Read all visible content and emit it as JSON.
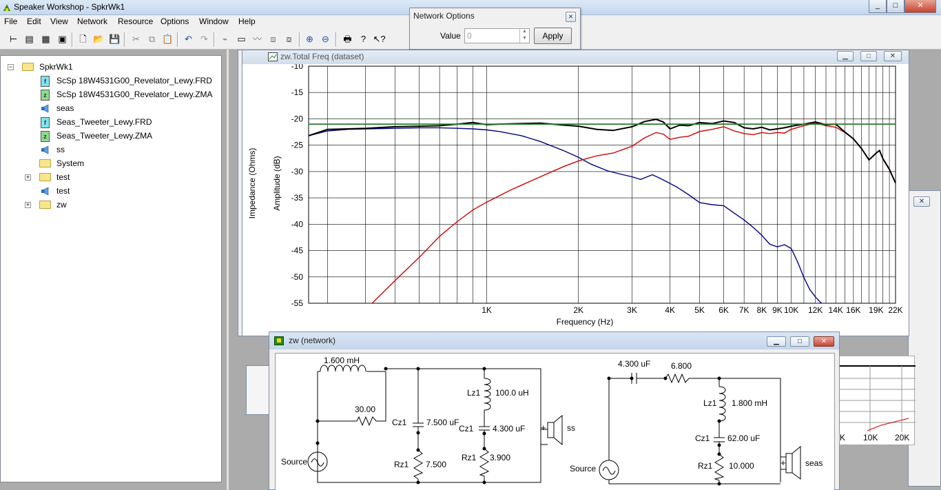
{
  "app": {
    "title": "Speaker Workshop - SpkrWk1",
    "caption_min": "_",
    "caption_max": "□",
    "caption_close": "✕"
  },
  "menu": [
    "File",
    "Edit",
    "View",
    "Network",
    "Resource",
    "Options",
    "Window",
    "Help"
  ],
  "toolbar": [
    "tree-view",
    "list-view",
    "details-view",
    "icons-view",
    "new",
    "open",
    "save",
    "cut",
    "copy",
    "paste",
    "undo",
    "redo",
    "measure",
    "chart",
    "impedance",
    "frequency",
    "transfer",
    "zoom-in",
    "zoom-out",
    "print",
    "help",
    "context-help"
  ],
  "network_options": {
    "title": "Network Options",
    "value_label": "Value",
    "value": "0",
    "apply_label": "Apply",
    "close": "✕"
  },
  "tree": {
    "items": [
      {
        "label": "SpkrWk1",
        "icon": "folder-icon",
        "expander": "−"
      },
      {
        "label": "ScSp 18W4531G00_Revelator_Lewy.FRD",
        "icon": "frequency-file-icon",
        "glyph": "f"
      },
      {
        "label": "ScSp 18W4531G00_Revelator_Lewy.ZMA",
        "icon": "impedance-file-icon",
        "glyph": "z"
      },
      {
        "label": "seas",
        "icon": "driver-icon"
      },
      {
        "label": "Seas_Tweeter_Lewy.FRD",
        "icon": "frequency-file-icon",
        "glyph": "f"
      },
      {
        "label": "Seas_Tweeter_Lewy.ZMA",
        "icon": "impedance-file-icon",
        "glyph": "z"
      },
      {
        "label": "ss",
        "icon": "driver-icon"
      },
      {
        "label": "System",
        "icon": "folder-icon"
      },
      {
        "label": "test",
        "icon": "folder-icon",
        "expander": "+"
      },
      {
        "label": "test",
        "icon": "driver-icon"
      },
      {
        "label": "zw",
        "icon": "folder-icon",
        "expander": "+"
      }
    ]
  },
  "freq_window": {
    "title": "zw.Total Freq (dataset)"
  },
  "network_window": {
    "title": "zw (network)"
  },
  "chart_data": {
    "type": "line",
    "x_scale": "log",
    "xlim": [
      260,
      22000
    ],
    "ylim": [
      -55,
      -10
    ],
    "xlabel": "Frequency (Hz)",
    "ylabel": "Amplitude (dB)",
    "y2label": "Impedance (Ohms)",
    "xticks": [
      {
        "v": 1000,
        "l": "1K"
      },
      {
        "v": 2000,
        "l": "2K"
      },
      {
        "v": 3000,
        "l": "3K"
      },
      {
        "v": 4000,
        "l": "4K"
      },
      {
        "v": 5000,
        "l": "5K"
      },
      {
        "v": 6000,
        "l": "6K"
      },
      {
        "v": 7000,
        "l": "7K"
      },
      {
        "v": 8000,
        "l": "8K"
      },
      {
        "v": 9000,
        "l": "9K"
      },
      {
        "v": 10000,
        "l": "10K"
      },
      {
        "v": 12000,
        "l": "12K"
      },
      {
        "v": 14000,
        "l": "14K"
      },
      {
        "v": 16000,
        "l": "16K"
      },
      {
        "v": 19000,
        "l": "19K"
      },
      {
        "v": 22000,
        "l": "22K"
      }
    ],
    "yticks": [
      -10,
      -15,
      -20,
      -25,
      -30,
      -35,
      -40,
      -45,
      -50,
      -55
    ],
    "grid": true,
    "series": [
      {
        "color": "#00007f",
        "width": 1.4,
        "x": [
          260,
          300,
          350,
          400,
          500,
          600,
          700,
          800,
          900,
          1000,
          1100,
          1300,
          1500,
          1800,
          2000,
          2200,
          2500,
          2800,
          3000,
          3200,
          3500,
          3800,
          4200,
          4600,
          5000,
          5500,
          6000,
          6500,
          7000,
          7500,
          8000,
          8500,
          9000,
          9500,
          10000,
          10500,
          11000,
          11500,
          12000,
          12500,
          13000
        ],
        "y": [
          -23.2,
          -22.3,
          -22.0,
          -21.9,
          -21.8,
          -21.7,
          -21.7,
          -21.8,
          -21.9,
          -22.1,
          -22.4,
          -23.2,
          -24.3,
          -26.1,
          -27.3,
          -28.6,
          -29.9,
          -30.6,
          -31.0,
          -31.5,
          -30.6,
          -31.6,
          -32.9,
          -34.4,
          -35.9,
          -36.3,
          -36.5,
          -37.9,
          -39.2,
          -40.6,
          -42.1,
          -43.8,
          -44.3,
          -43.9,
          -44.6,
          -47.2,
          -50.1,
          -52.4,
          -53.8,
          -54.9,
          -55.5
        ]
      },
      {
        "color": "#d00000",
        "width": 1.4,
        "x": [
          420,
          500,
          600,
          700,
          800,
          900,
          1000,
          1200,
          1500,
          1800,
          2000,
          2300,
          2600,
          3000,
          3300,
          3600,
          3800,
          4000,
          4300,
          4600,
          5000,
          5500,
          6000,
          6500,
          7000,
          7500,
          8000,
          8500,
          9000,
          9500,
          10000,
          11000,
          12000,
          13000,
          14000,
          15000,
          16000,
          17000,
          18000,
          19000,
          19500,
          20000,
          21000,
          22000
        ],
        "y": [
          -55.0,
          -50.7,
          -46.3,
          -42.3,
          -39.5,
          -37.3,
          -35.8,
          -33.5,
          -31.0,
          -29.0,
          -28.0,
          -27.0,
          -26.5,
          -25.2,
          -23.6,
          -22.6,
          -22.9,
          -23.9,
          -23.5,
          -23.3,
          -22.4,
          -22.0,
          -21.5,
          -22.3,
          -22.8,
          -23.0,
          -22.6,
          -22.8,
          -22.6,
          -22.7,
          -22.0,
          -21.3,
          -20.8,
          -21.3,
          -21.6,
          -22.6,
          -23.8,
          -25.6,
          -27.8,
          -26.5,
          -26.0,
          -27.5,
          -29.5,
          -32.2
        ]
      },
      {
        "color": "#000000",
        "width": 2.0,
        "x": [
          260,
          300,
          350,
          400,
          500,
          600,
          700,
          800,
          900,
          1000,
          1100,
          1300,
          1500,
          1800,
          2000,
          2300,
          2600,
          3000,
          3300,
          3600,
          3800,
          4000,
          4300,
          4600,
          5000,
          5500,
          6000,
          6500,
          7000,
          7500,
          8000,
          8500,
          9000,
          9500,
          10000,
          11000,
          12000,
          13000,
          14000,
          15000,
          16000,
          17000,
          18000,
          19000,
          19500,
          20000,
          21000,
          22000
        ],
        "y": [
          -23.2,
          -22.0,
          -21.9,
          -21.8,
          -21.5,
          -21.4,
          -21.3,
          -21.0,
          -20.7,
          -21.1,
          -21.0,
          -20.9,
          -20.8,
          -21.2,
          -21.4,
          -22.0,
          -22.2,
          -21.5,
          -20.5,
          -20.1,
          -20.6,
          -21.9,
          -21.2,
          -21.3,
          -20.7,
          -20.9,
          -20.4,
          -20.7,
          -21.7,
          -21.9,
          -21.6,
          -22.1,
          -21.9,
          -21.7,
          -21.4,
          -21.0,
          -20.6,
          -21.1,
          -21.0,
          -22.5,
          -23.8,
          -25.6,
          -27.8,
          -26.5,
          -26.0,
          -27.6,
          -29.6,
          -32.2
        ]
      },
      {
        "color": "#2a7a2a",
        "width": 1.8,
        "x": [
          260,
          22000
        ],
        "y": [
          -21.0,
          -21.0
        ]
      }
    ]
  },
  "circuit_left": {
    "labels": {
      "l1": "1.600 mH",
      "r_series": "30.00",
      "cz1a": "Cz1",
      "cz1a_val": "7.500 uF",
      "lz1": "Lz1",
      "lz1_val": "100.0 uH",
      "cz1b": "Cz1",
      "cz1b_val": "4.300 uF",
      "rz1a": "Rz1",
      "rz1a_val": "7.500",
      "rz1b": "Rz1",
      "rz1b_val": "3.900",
      "source": "Source",
      "driver": "ss",
      "plus": "+"
    }
  },
  "circuit_right": {
    "labels": {
      "c1": "4.300 uF",
      "r1": "6.800",
      "lz1": "Lz1",
      "lz1_val": "1.800 mH",
      "cz1": "Cz1",
      "cz1_val": "62.00 uF",
      "rz1": "Rz1",
      "rz1_val": "10.000",
      "source": "Source",
      "driver": "seas",
      "plus": "+"
    }
  },
  "bg_chart": {
    "ticks": [
      "K",
      "10K",
      "20K"
    ]
  }
}
